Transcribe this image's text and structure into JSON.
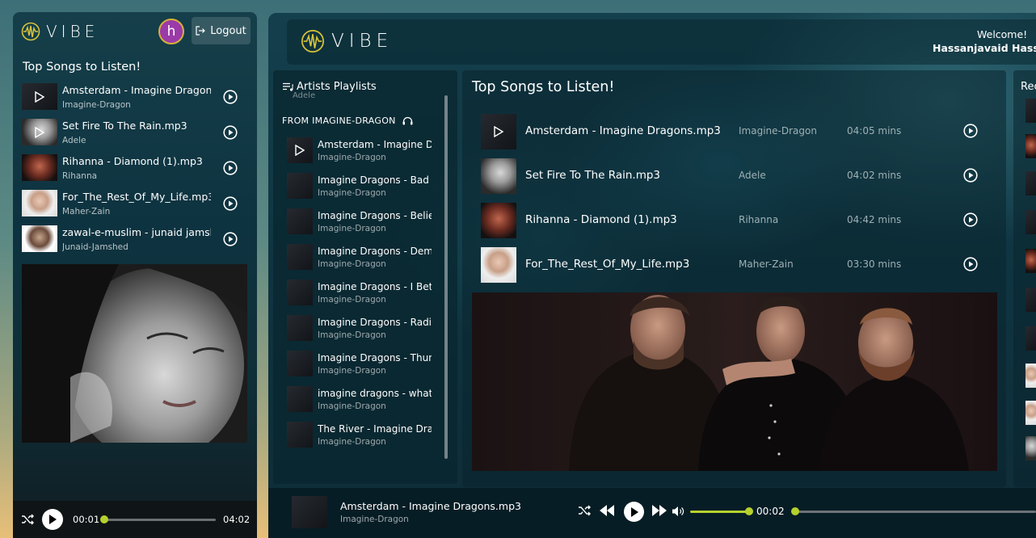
{
  "brand": "VIBE",
  "mobile": {
    "avatar_letter": "h",
    "logout_label": "Logout",
    "section_title": "Top Songs to Listen!",
    "songs": [
      {
        "title": "Amsterdam - Imagine Dragons",
        "artist": "Imagine-Dragon",
        "thumb": "band",
        "overlay": true
      },
      {
        "title": "Set Fire To The Rain.mp3",
        "artist": "Adele",
        "thumb": "adele",
        "overlay": true
      },
      {
        "title": "Rihanna - Diamond (1).mp3",
        "artist": "Rihanna",
        "thumb": "rihanna",
        "overlay": false
      },
      {
        "title": "For_The_Rest_Of_My_Life.mp3",
        "artist": "Maher-Zain",
        "thumb": "maher",
        "overlay": false
      },
      {
        "title": "zawal-e-muslim - junaid jamsh",
        "artist": "Junaid-Jamshed",
        "thumb": "junaid",
        "overlay": false
      }
    ],
    "player": {
      "current_time": "00:01",
      "total_time": "04:02",
      "progress": 0.02
    }
  },
  "desktop": {
    "header": {
      "welcome": "Welcome!",
      "username": "Hassanjavaid Hassan"
    },
    "playlists": {
      "title": "Artists Playlists",
      "ghost_text": "Adele",
      "section": "FROM IMAGINE-DRAGON",
      "items": [
        {
          "title": "Amsterdam - Imagine D",
          "artist": "Imagine-Dragon",
          "overlay": true
        },
        {
          "title": "Imagine Dragons - Bad I",
          "artist": "Imagine-Dragon"
        },
        {
          "title": "Imagine Dragons - Belie",
          "artist": "Imagine-Dragon"
        },
        {
          "title": "Imagine Dragons - Dem",
          "artist": "Imagine-Dragon"
        },
        {
          "title": "Imagine Dragons - I Bet",
          "artist": "Imagine-Dragon"
        },
        {
          "title": "Imagine Dragons - Radi",
          "artist": "Imagine-Dragon"
        },
        {
          "title": "Imagine Dragons - Thun",
          "artist": "Imagine-Dragon"
        },
        {
          "title": "imagine dragons - what",
          "artist": "Imagine-Dragon"
        },
        {
          "title": "The River - Imagine Drag",
          "artist": "Imagine-Dragon"
        }
      ]
    },
    "main": {
      "title": "Top Songs to Listen!",
      "songs": [
        {
          "title": "Amsterdam - Imagine Dragons.mp3",
          "artist": "Imagine-Dragon",
          "duration": "04:05 mins",
          "thumb": "band",
          "overlay": true
        },
        {
          "title": "Set Fire To The Rain.mp3",
          "artist": "Adele",
          "duration": "04:02 mins",
          "thumb": "adele",
          "overlay": false
        },
        {
          "title": "Rihanna - Diamond (1).mp3",
          "artist": "Rihanna",
          "duration": "04:42 mins",
          "thumb": "rihanna",
          "overlay": false
        },
        {
          "title": "For_The_Rest_Of_My_Life.mp3",
          "artist": "Maher-Zain",
          "duration": "03:30 mins",
          "thumb": "maher",
          "overlay": false
        }
      ]
    },
    "recent": {
      "title": "Rec"
    },
    "player": {
      "title": "Amsterdam - Imagine Dragons.mp3",
      "artist": "Imagine-Dragon",
      "current_time": "00:02",
      "volume": 1.0,
      "progress": 0.01
    },
    "colors": {
      "accent": "#b6d12d",
      "panel": "#0f3441"
    }
  }
}
